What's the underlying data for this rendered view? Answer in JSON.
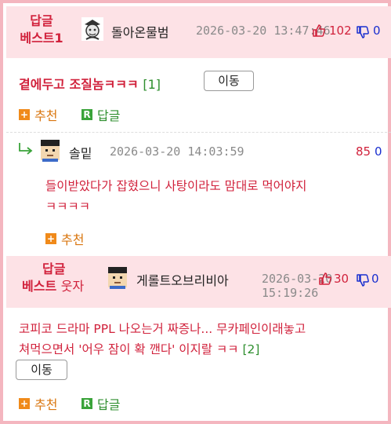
{
  "comments": [
    {
      "badge_line1": "답글",
      "badge_line2": "베스트1",
      "nickname": "돌아온물범",
      "date": "2026-03-20 13:47:46",
      "upvotes": "102",
      "downvotes": "0",
      "title": "곁에두고 조질놈ㅋㅋㅋ",
      "reply_count": "[1]",
      "move_label": "이동",
      "recommend_label": "추천",
      "reply_label": "답글"
    },
    {
      "nickname": "솔밑",
      "date": "2026-03-20 14:03:59",
      "upvotes": "85",
      "downvotes": "0",
      "body_line1": "들이받았다가 잡혔으니 사탕이라도 맘대로 먹어야지",
      "body_line2": "ㅋㅋㅋㅋ",
      "recommend_label": "추천"
    },
    {
      "badge_line1": "답글",
      "badge_line2_a": "베스트",
      "badge_line2_b": "웃자",
      "nickname": "게롤트오브리비아",
      "date": "2026-03-20 15:19:26",
      "upvotes": "30",
      "downvotes": "0",
      "body_line1": "코피코 드라마 PPL 나오는거 짜증나... 무카페인이래놓고",
      "body_line2": "쳐먹으면서 '어우 잠이 확 깬다' 이지랄 ㅋㅋ",
      "reply_count": "[2]",
      "move_label": "이동",
      "recommend_label": "추천",
      "reply_label": "답글"
    }
  ],
  "colors": {
    "accent_red": "#d1223c",
    "header_bg": "#fde2e6",
    "border_pink": "#f4b6bf",
    "reply_green": "#3aa33a",
    "recommend_orange": "#f08a1a",
    "down_blue": "#1a2fcf"
  },
  "icons": [
    "thumbs-up-icon",
    "thumbs-down-icon",
    "plus-icon",
    "reply-r-icon",
    "reply-arrow-icon",
    "avatar-icon"
  ]
}
